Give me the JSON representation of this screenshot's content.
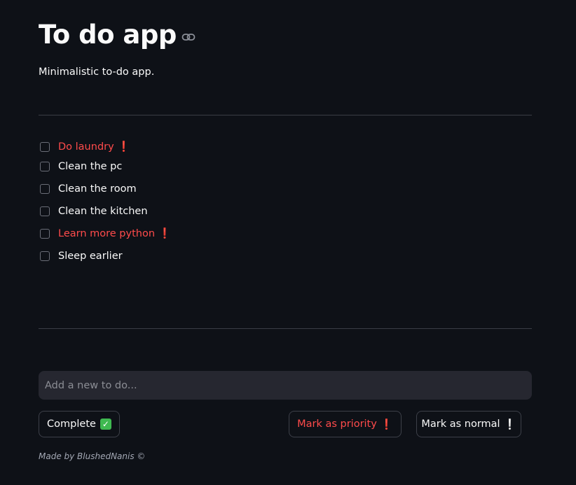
{
  "app": {
    "title": "To do app",
    "subtitle": "Minimalistic to-do app."
  },
  "todos": [
    {
      "label": "Do laundry",
      "priority": true,
      "marker": "❗"
    },
    {
      "label": "Clean the pc",
      "priority": false,
      "marker": ""
    },
    {
      "label": "Clean the room",
      "priority": false,
      "marker": ""
    },
    {
      "label": "Clean the kitchen",
      "priority": false,
      "marker": ""
    },
    {
      "label": "Learn more python",
      "priority": true,
      "marker": "❗"
    },
    {
      "label": "Sleep earlier",
      "priority": false,
      "marker": ""
    }
  ],
  "new_todo": {
    "placeholder": "Add a new to do...",
    "value": ""
  },
  "buttons": {
    "complete_label": "Complete",
    "complete_emoji": "✓",
    "priority_label": "Mark as priority",
    "priority_marker": "❗",
    "normal_label": "Mark as normal",
    "normal_marker": "❕"
  },
  "footer": {
    "text": "Made by BlushedNanis ©"
  },
  "colors": {
    "background": "#0e1117",
    "priority": "#ff4b4b",
    "input_bg": "#262730",
    "success": "#3fb950"
  },
  "icons": {
    "title_link": "link-icon",
    "checkbox": "checkbox-icon",
    "complete": "check-mark-icon",
    "priority": "red-exclamation-icon",
    "normal": "grey-exclamation-icon"
  }
}
